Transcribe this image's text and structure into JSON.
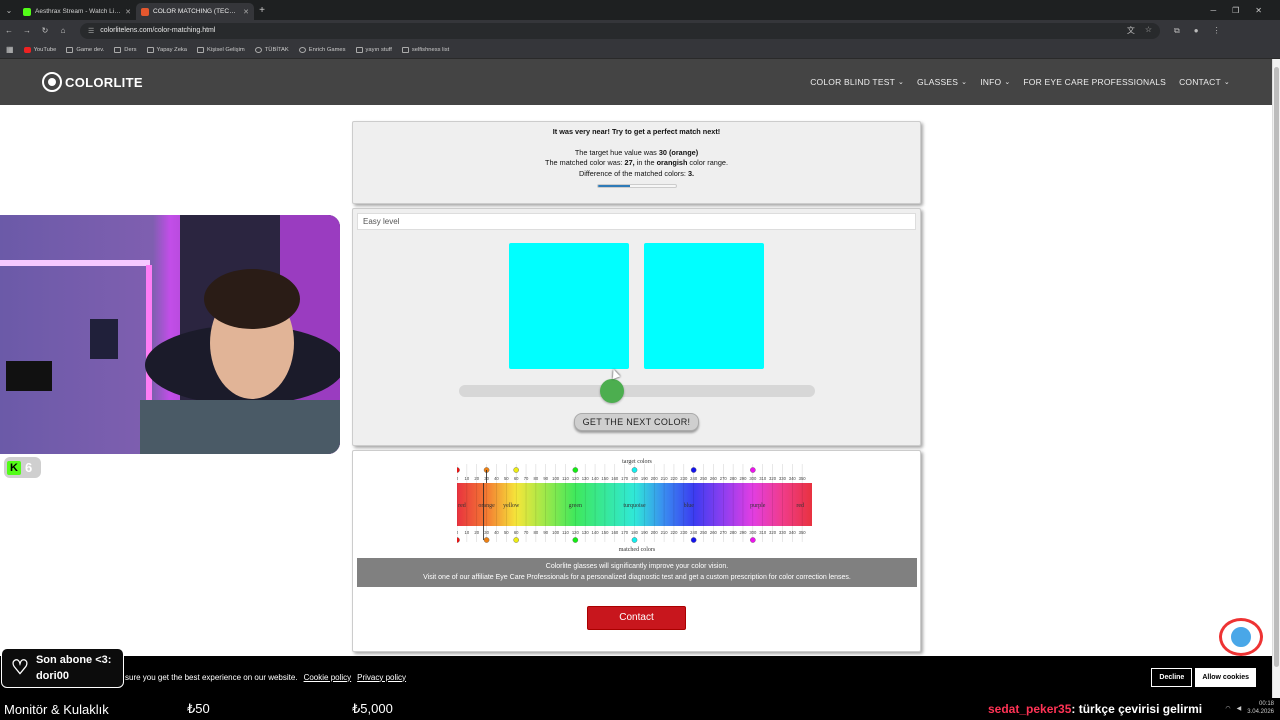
{
  "browser": {
    "tabs": [
      {
        "title": "Aesthrax Stream - Watch Live o",
        "favicon_color": "#53fc18",
        "active": false
      },
      {
        "title": "COLOR MATCHING (TECHNICA",
        "favicon_color": "#e4572e",
        "active": true
      }
    ],
    "url": "colorlitelens.com/color-matching.html",
    "bookmarks": [
      "YouTube",
      "Game dev.",
      "Ders",
      "Yapay Zeka",
      "Kişisel Gelişim",
      "TÜBİTAK",
      "Enrich Games",
      "yayın stuff",
      "selfishness list"
    ]
  },
  "site": {
    "logo_text": "COLORLITE",
    "nav": [
      {
        "label": "COLOR BLIND TEST",
        "dropdown": true
      },
      {
        "label": "GLASSES",
        "dropdown": true
      },
      {
        "label": "INFO",
        "dropdown": true
      },
      {
        "label": "FOR EYE CARE PROFESSIONALS",
        "dropdown": false
      },
      {
        "label": "CONTACT",
        "dropdown": true
      }
    ]
  },
  "result": {
    "headline": "It was very near! Try to get a perfect match next!",
    "line1_prefix": "The target hue value was ",
    "line1_value": "30 (orange)",
    "line2_prefix": "The matched color was: ",
    "line2_value": "27,",
    "line2_mid": " in the ",
    "line2_range": "orangish",
    "line2_suffix": " color range.",
    "line3_prefix": "Difference of the matched colors: ",
    "line3_value": "3.",
    "progress_fraction": 0.42
  },
  "game": {
    "level": "Easy level",
    "target_color": "#00ffff",
    "matched_color": "#00ffff",
    "slider_fraction": 0.43,
    "next_button": "GET THE NEXT COLOR!"
  },
  "spectrum": {
    "top_label": "target colors",
    "bottom_label": "matched colors",
    "ticks": [
      "0",
      "10",
      "20",
      "30",
      "40",
      "50",
      "60",
      "70",
      "80",
      "90",
      "100",
      "110",
      "120",
      "130",
      "140",
      "150",
      "160",
      "170",
      "180",
      "190",
      "200",
      "210",
      "220",
      "230",
      "240",
      "250",
      "260",
      "270",
      "280",
      "290",
      "300",
      "310",
      "320",
      "330",
      "340",
      "350"
    ],
    "band_labels": [
      {
        "text": "red",
        "hue": 5
      },
      {
        "text": "orange",
        "hue": 30
      },
      {
        "text": "yellow",
        "hue": 55
      },
      {
        "text": "green",
        "hue": 120
      },
      {
        "text": "turquoise",
        "hue": 180
      },
      {
        "text": "blue",
        "hue": 235
      },
      {
        "text": "purple",
        "hue": 305
      },
      {
        "text": "red",
        "hue": 348
      }
    ],
    "target_markers": [
      0,
      30,
      60,
      120,
      180,
      240,
      300
    ],
    "matched_markers": [
      0,
      30,
      60,
      120,
      180,
      240,
      300
    ],
    "selected_target_hue": 30,
    "selected_matched_hue": 27
  },
  "promo": {
    "line1": "Colorlite glasses will significantly improve your color vision.",
    "line2": "Visit one of our affiliate Eye Care Professionals for a personalized diagnostic test and get a custom prescription for color correction lenses."
  },
  "contact_button": "Contact",
  "cookie": {
    "message": "sure you get the best experience on our website.",
    "cookie_policy": "Cookie policy",
    "privacy_policy": "Privacy policy",
    "decline": "Decline",
    "allow": "Allow cookies"
  },
  "overlay": {
    "kick_viewers": "6",
    "sub_title": "Son abone <3:",
    "sub_name": "dori00",
    "ticker_item": "Monitör & Kulaklık",
    "price1": "₺50",
    "price2": "₺5,000",
    "chat_user": "sedat_peker35",
    "chat_msg": ": türkçe çevirisi gelirmi",
    "clock_time": "00:18",
    "clock_date": "3.04.2026"
  }
}
